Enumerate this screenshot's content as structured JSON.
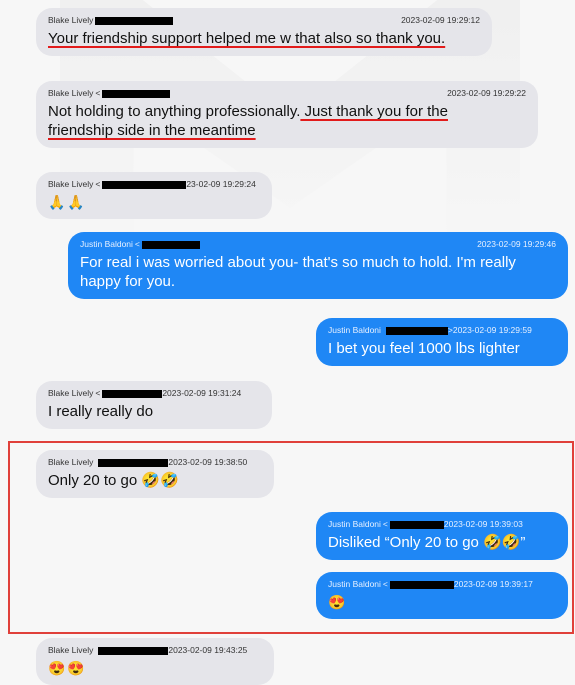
{
  "messages": [
    {
      "sender": "Blake Lively",
      "ts": "2023-02-09 19:29:12",
      "text": "Your friendship support helped me w that also so thank you."
    },
    {
      "sender": "Blake Lively",
      "ts": "2023-02-09 19:29:22",
      "text_plain": "Not holding to anything professionally.",
      "text_underlined_1": " Just thank you for the",
      "text_underlined_2": "friendship side in the meantime"
    },
    {
      "sender": "Blake Lively",
      "ts_fragment": "23-02-09 19:29:24",
      "emoji": "🙏🙏"
    },
    {
      "sender": "Justin Baldoni",
      "ts": "2023-02-09 19:29:46",
      "text": "For real i was worried about you- that's so much to hold. I'm really happy for you."
    },
    {
      "sender": "Justin Baldoni",
      "ts": ">2023-02-09 19:29:59",
      "text": "I bet you feel 1000 lbs lighter"
    },
    {
      "sender": "Blake Lively",
      "ts_fragment": "2023-02-09 19:31:24",
      "text": "I really really do"
    },
    {
      "sender": "Blake Lively",
      "ts_fragment": "2023-02-09 19:38:50",
      "text": "Only 20 to go 🤣🤣"
    },
    {
      "sender": "Justin Baldoni",
      "ts_fragment": "2023-02-09 19:39:03",
      "text": "Disliked “Only 20 to go 🤣🤣”"
    },
    {
      "sender": "Justin Baldoni",
      "ts_fragment": "2023-02-09 19:39:17",
      "emoji": "😍"
    },
    {
      "sender": "Blake Lively",
      "ts_fragment": "2023-02-09 19:43:25",
      "emoji": "😍😍"
    }
  ],
  "colors": {
    "incoming": "#e5e5ea",
    "outgoing": "#1f87f5",
    "annotation_red": "#e0403a"
  },
  "icons": {
    "redaction": "redaction-bar"
  }
}
